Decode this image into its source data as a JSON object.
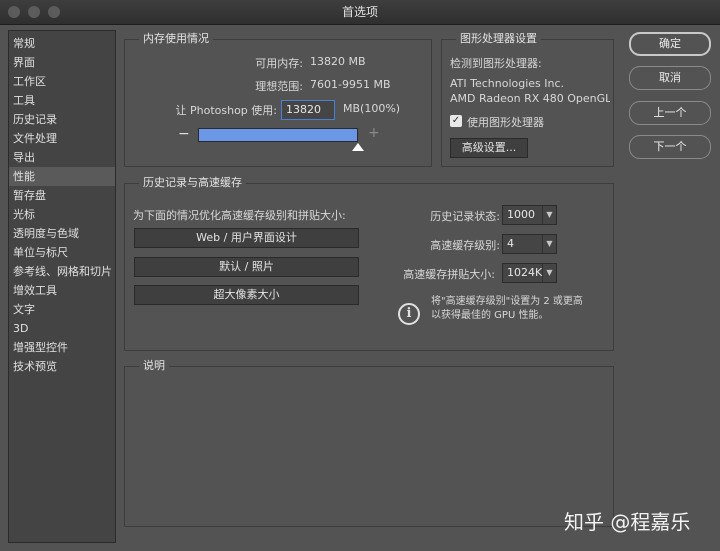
{
  "window": {
    "title": "首选项"
  },
  "sidebar": {
    "items": [
      {
        "label": "常规"
      },
      {
        "label": "界面"
      },
      {
        "label": "工作区"
      },
      {
        "label": "工具"
      },
      {
        "label": "历史记录"
      },
      {
        "label": "文件处理"
      },
      {
        "label": "导出"
      },
      {
        "label": "性能"
      },
      {
        "label": "暂存盘"
      },
      {
        "label": "光标"
      },
      {
        "label": "透明度与色域"
      },
      {
        "label": "单位与标尺"
      },
      {
        "label": "参考线、网格和切片"
      },
      {
        "label": "增效工具"
      },
      {
        "label": "文字"
      },
      {
        "label": "3D"
      },
      {
        "label": "增强型控件"
      },
      {
        "label": "技术预览"
      }
    ],
    "selected": "性能"
  },
  "memory": {
    "title": "内存使用情况",
    "available_label": "可用内存:",
    "available_value": "13820 MB",
    "ideal_label": "理想范围:",
    "ideal_value": "7601-9951 MB",
    "let_label": "让 Photoshop 使用:",
    "let_value": "13820",
    "unit": "MB(100%)",
    "minus": "−",
    "plus": "+",
    "slider_fraction": 1.0
  },
  "gpu": {
    "title": "图形处理器设置",
    "detected_label": "检测到图形处理器:",
    "vendor": "ATI Technologies Inc.",
    "model": "AMD Radeon RX 480 OpenGL...",
    "checkbox_checked": true,
    "checkbox_label": "使用图形处理器",
    "advanced_button": "高级设置..."
  },
  "history_cache": {
    "title": "历史记录与高速缓存",
    "optimize_label": "为下面的情况优化高速缓存级别和拼贴大小:",
    "presets": [
      "Web / 用户界面设计",
      "默认 / 照片",
      "超大像素大小"
    ],
    "history_states_label": "历史记录状态:",
    "history_states_value": "1000",
    "cache_levels_label": "高速缓存级别:",
    "cache_levels_value": "4",
    "tile_size_label": "高速缓存拼贴大小:",
    "tile_size_value": "1024K",
    "info_line1": "将\"高速缓存级别\"设置为 2 或更高",
    "info_line2": "以获得最佳的 GPU 性能。"
  },
  "description": {
    "title": "说明"
  },
  "buttons": {
    "ok": "确定",
    "cancel": "取消",
    "prev": "上一个",
    "next": "下一个"
  },
  "watermark": "知乎 @程嘉乐",
  "colors": {
    "accent": "#6a97e6",
    "background": "#535353"
  }
}
